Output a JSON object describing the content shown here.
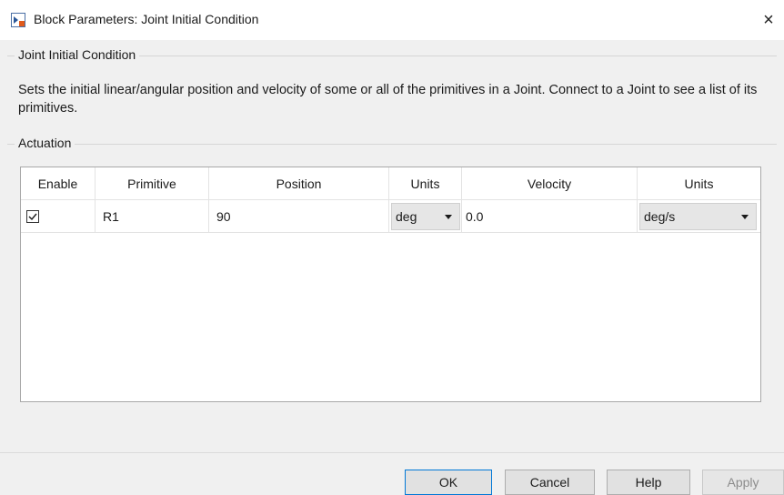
{
  "window": {
    "title": "Block Parameters: Joint Initial Condition",
    "close_glyph": "×"
  },
  "section1": {
    "label": "Joint Initial Condition",
    "description": "Sets the initial linear/angular position and velocity of some or all of the primitives in a Joint. Connect to a Joint to see a list of its primitives."
  },
  "section2": {
    "label": "Actuation"
  },
  "table": {
    "headers": [
      "Enable",
      "Primitive",
      "Position",
      "Units",
      "Velocity",
      "Units"
    ],
    "rows": [
      {
        "enabled": true,
        "primitive": "R1",
        "position": "90",
        "position_units": "deg",
        "velocity": "0.0",
        "velocity_units": "deg/s"
      }
    ]
  },
  "buttons": {
    "ok": "OK",
    "cancel": "Cancel",
    "help": "Help",
    "apply": "Apply"
  },
  "colors": {
    "accent": "#0078d7",
    "dialog_bg": "#f0f0f0"
  }
}
